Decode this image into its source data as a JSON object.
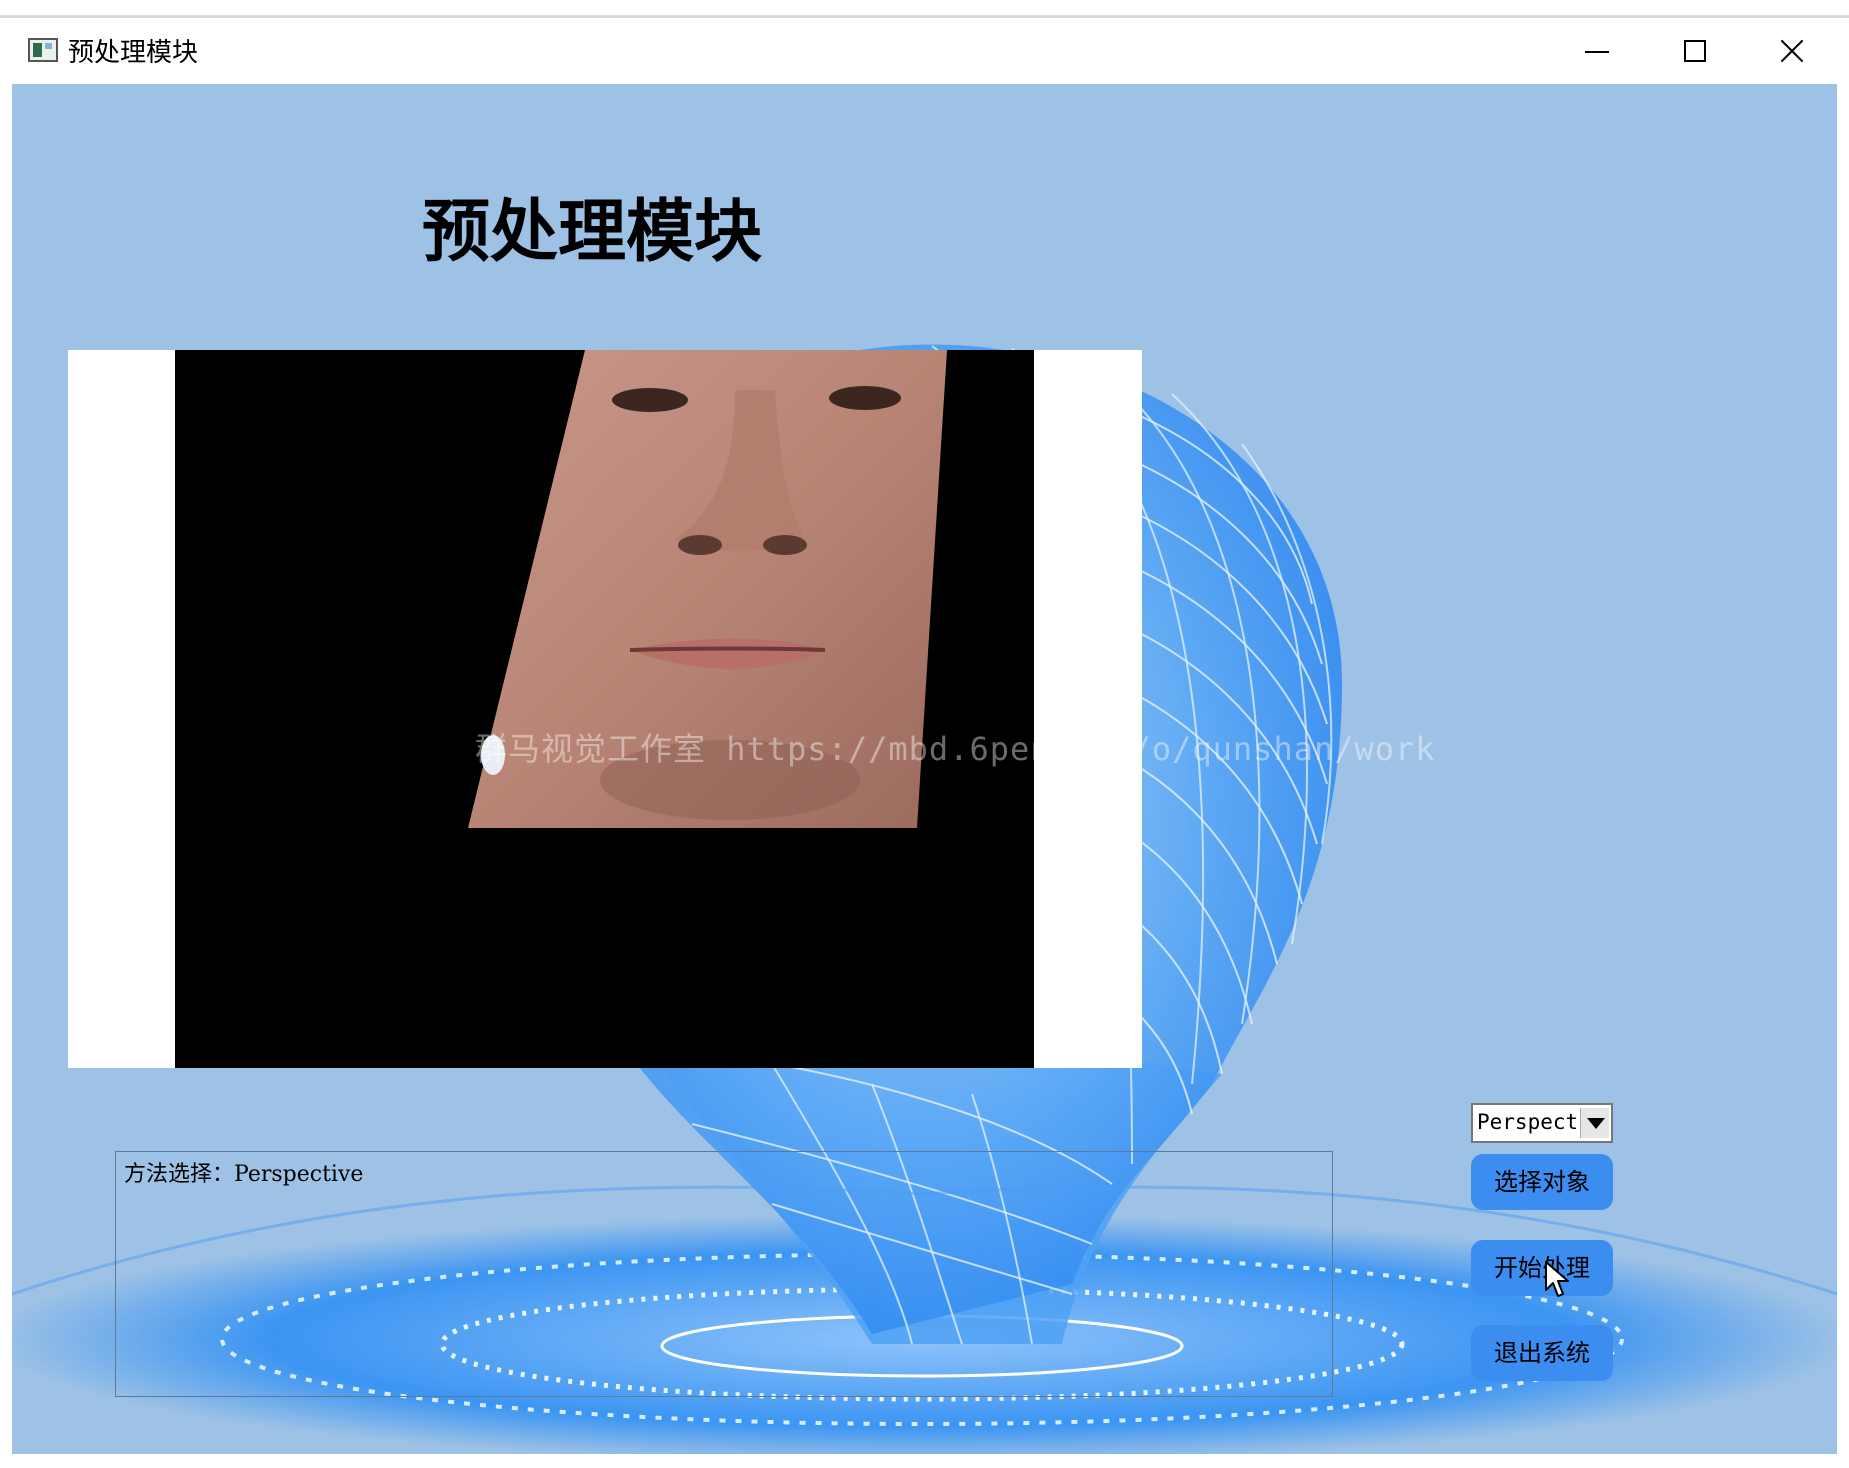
{
  "window": {
    "title": "预处理模块",
    "minimize_icon": "minimize-icon",
    "maximize_icon": "maximize-icon",
    "close_icon": "close-icon"
  },
  "main": {
    "heading": "预处理模块",
    "watermark": "群马视觉工作室 https://mbd.6pen.art/o/qunshan/work",
    "log_text": "方法选择：Perspective"
  },
  "controls": {
    "method_select": {
      "value": "Perspective"
    },
    "select_object_label": "选择对象",
    "start_label": "开始处理",
    "exit_label": "退出系统"
  },
  "colors": {
    "background": "#9ec2e6",
    "button": "#3b8df0",
    "wireframe": "#2f8ff5"
  }
}
